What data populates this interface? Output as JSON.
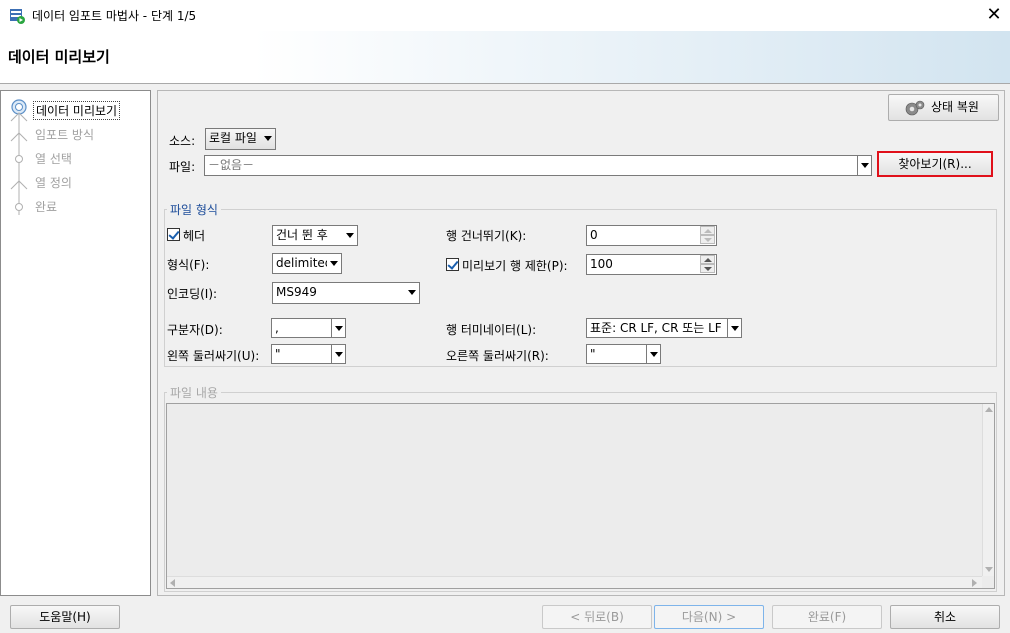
{
  "window": {
    "title": "데이터 임포트 마법사 - 단계 1/5",
    "close_glyph": "✕"
  },
  "banner": {
    "title": "데이터 미리보기"
  },
  "steps": [
    {
      "label": "데이터 미리보기",
      "active": true
    },
    {
      "label": "임포트 방식",
      "active": false
    },
    {
      "label": "열 선택",
      "active": false
    },
    {
      "label": "열 정의",
      "active": false
    },
    {
      "label": "완료",
      "active": false
    }
  ],
  "toolbar": {
    "restore_label": "상태 복원"
  },
  "source": {
    "label": "소스:",
    "value": "로컬 파일"
  },
  "file": {
    "label": "파일:",
    "value": "－없음－",
    "browse_label": "찾아보기(R)..."
  },
  "format_group": {
    "title": "파일 형식",
    "header_label": "헤더",
    "header_checked": true,
    "header_value": "건너 뛴 후",
    "skip_rows_label": "행 건너뛰기(K):",
    "skip_rows_value": "0",
    "format_label": "형식(F):",
    "format_value": "delimited",
    "preview_limit_label": "미리보기 행 제한(P):",
    "preview_limit_checked": true,
    "preview_limit_value": "100",
    "encoding_label": "인코딩(I):",
    "encoding_value": "MS949",
    "delimiter_label": "구분자(D):",
    "delimiter_value": ",",
    "terminator_label": "행 터미네이터(L):",
    "terminator_value": "표준: CR LF, CR 또는 LF",
    "left_enclosure_label": "왼쪽 둘러싸기(U):",
    "left_enclosure_value": "\"",
    "right_enclosure_label": "오른쪽 둘러싸기(R):",
    "right_enclosure_value": "\""
  },
  "content_group": {
    "title": "파일 내용"
  },
  "footer": {
    "help_label": "도움말(H)",
    "back_label": "< 뒤로(B)",
    "next_label": "다음(N) >",
    "finish_label": "완료(F)",
    "cancel_label": "취소"
  },
  "colors": {
    "highlight_border": "#e0101a",
    "banner_gradient_end": "#d2e4f0"
  }
}
